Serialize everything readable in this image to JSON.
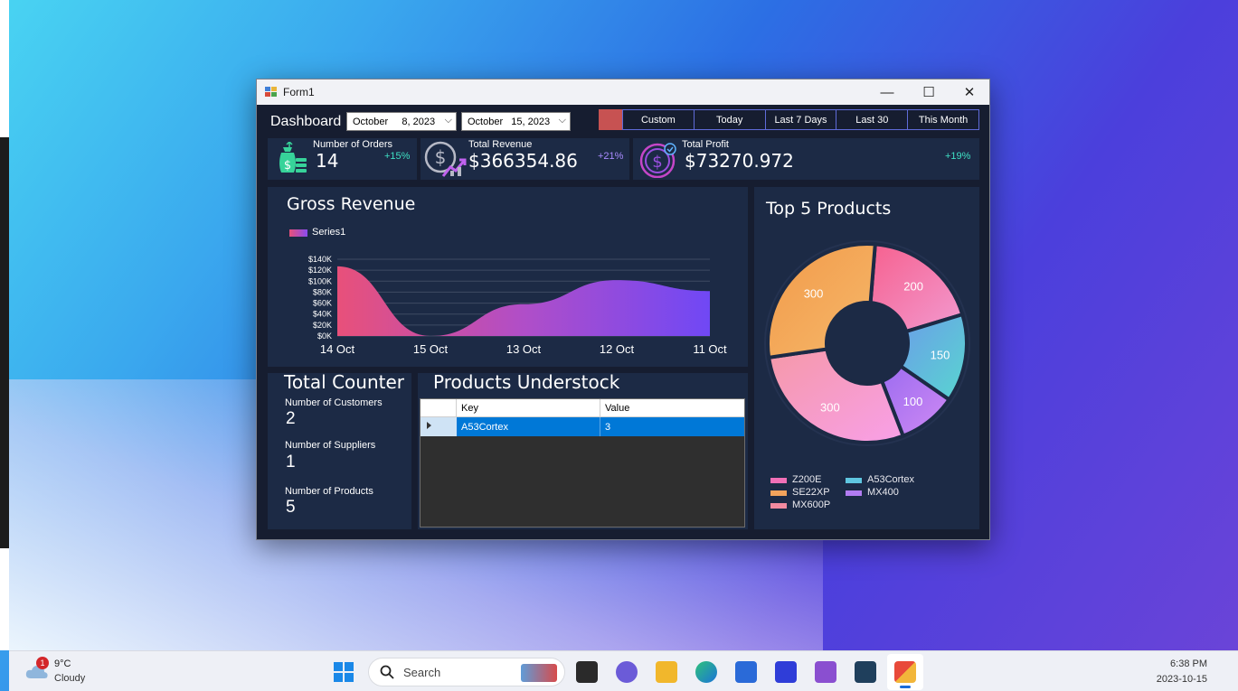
{
  "window": {
    "title": "Form1",
    "minimize_glyph": "—",
    "maximize_glyph": "☐",
    "close_glyph": "✕"
  },
  "header": {
    "title": "Dashboard",
    "start_date": "October     8, 2023",
    "end_date": "October   15, 2023",
    "filters": [
      "Custom",
      "Today",
      "Last 7 Days",
      "Last 30",
      "This Month"
    ],
    "custom_swatch_color": "#c75252"
  },
  "kpis": [
    {
      "label": "Number of Orders",
      "value": "14",
      "change": "+15%"
    },
    {
      "label": "Total Revenue",
      "value": "$366354.86",
      "change": "+21%"
    },
    {
      "label": "Total Profit",
      "value": "$73270.972",
      "change": "+19%"
    }
  ],
  "gross_revenue": {
    "title": "Gross Revenue",
    "legend": "Series1",
    "y_ticks": [
      "$140K",
      "$120K",
      "$100K",
      "$80K",
      "$60K",
      "$40K",
      "$20K",
      "$0K"
    ],
    "x_ticks": [
      "14 Oct",
      "15 Oct",
      "13 Oct",
      "12 Oct",
      "11 Oct"
    ]
  },
  "top_products": {
    "title": "Top 5 Products",
    "legend": [
      "Z200E",
      "A53Cortex",
      "SE22XP",
      "MX400",
      "MX600P"
    ]
  },
  "chart_data": [
    {
      "type": "area",
      "title": "Gross Revenue",
      "x": [
        "14 Oct",
        "15 Oct",
        "13 Oct",
        "12 Oct",
        "11 Oct"
      ],
      "series": [
        {
          "name": "Series1",
          "values": [
            127000,
            0,
            58000,
            102000,
            82000
          ]
        }
      ],
      "ylim": [
        0,
        140000
      ],
      "grid": true,
      "legend_position": "top-left"
    },
    {
      "type": "pie",
      "title": "Top 5 Products",
      "categories": [
        "Z200E",
        "A53Cortex",
        "MX400",
        "MX600P",
        "SE22XP"
      ],
      "values": [
        200,
        150,
        100,
        300,
        300
      ],
      "donut": true,
      "legend_position": "bottom"
    }
  ],
  "total_counter": {
    "title": "Total Counter",
    "customers_label": "Number of Customers",
    "customers_value": "2",
    "suppliers_label": "Number of Suppliers",
    "suppliers_value": "1",
    "products_label": "Number of Products",
    "products_value": "5"
  },
  "understock": {
    "title": "Products Understock",
    "columns": [
      "Key",
      "Value"
    ],
    "rows": [
      [
        "A53Cortex",
        "3"
      ]
    ]
  },
  "taskbar": {
    "temperature": "9°C",
    "weather": "Cloudy",
    "weather_badge": "1",
    "search_placeholder": "Search",
    "time": "6:38 PM",
    "date": "2023-10-15"
  },
  "colors": {
    "panel": "#1c2a45",
    "background": "#161d30",
    "accent_green": "#3fe0c4",
    "accent_purple": "#9b6cff",
    "selection": "#0078d7"
  }
}
